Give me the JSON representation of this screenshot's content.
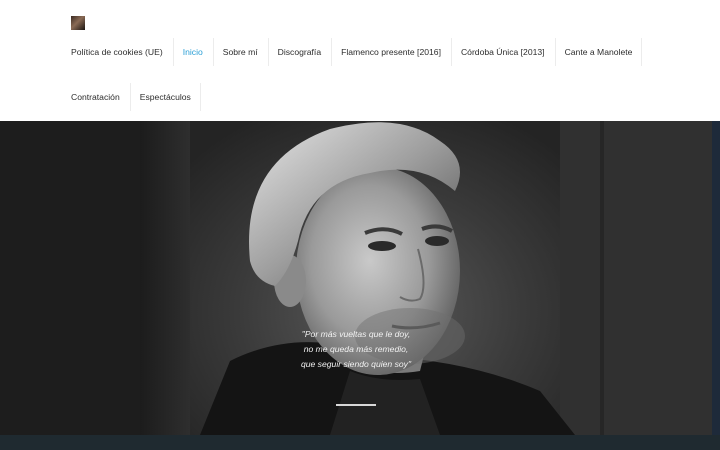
{
  "header": {
    "logo_alt": "site-logo",
    "nav_row1": [
      {
        "label": "Política de cookies (UE)",
        "active": false
      },
      {
        "label": "Inicio",
        "active": true
      },
      {
        "label": "Sobre mí",
        "active": false
      },
      {
        "label": "Discografía",
        "active": false
      },
      {
        "label": "Flamenco presente [2016]",
        "active": false
      },
      {
        "label": "Córdoba Única [2013]",
        "active": false
      },
      {
        "label": "Cante a Manolete",
        "active": false
      }
    ],
    "nav_row2": [
      {
        "label": "Contratación",
        "active": false
      },
      {
        "label": "Espectáculos",
        "active": false
      }
    ]
  },
  "hero": {
    "quote_lines": [
      "\"Por más vueltas que le doy,",
      "no me queda más remedio,",
      "que seguir siendo quien soy\""
    ]
  },
  "colors": {
    "accent": "#2a9fd6",
    "nav_text": "#2d2d2d",
    "band": "#1f2a30"
  }
}
